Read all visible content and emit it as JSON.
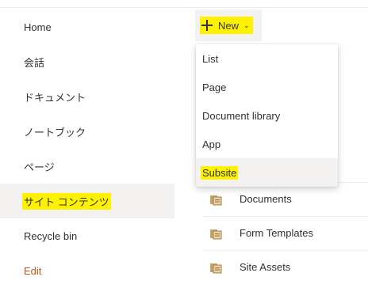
{
  "sidebar": {
    "items": [
      {
        "label": "Home"
      },
      {
        "label": "会話"
      },
      {
        "label": "ドキュメント"
      },
      {
        "label": "ノートブック"
      },
      {
        "label": "ページ"
      },
      {
        "label": "サイト コンテンツ",
        "selected": true
      },
      {
        "label": "Recycle bin"
      },
      {
        "label": "Edit"
      }
    ]
  },
  "toolbar": {
    "new_label": "New",
    "new_icon": "plus-icon",
    "chevron_icon": "chevron-down-icon"
  },
  "new_menu": {
    "items": [
      {
        "label": "List"
      },
      {
        "label": "Page"
      },
      {
        "label": "Document library"
      },
      {
        "label": "App"
      },
      {
        "label": "Subsite",
        "highlighted": true
      }
    ]
  },
  "contents": {
    "rows": [
      {
        "label": "Documents",
        "icon": "library-icon"
      },
      {
        "label": "Form Templates",
        "icon": "library-icon"
      },
      {
        "label": "Site Assets",
        "icon": "library-icon"
      }
    ]
  },
  "colors": {
    "highlight": "#fff200",
    "selected_bg": "#f3f2f1",
    "edit_link": "#c0571b"
  }
}
